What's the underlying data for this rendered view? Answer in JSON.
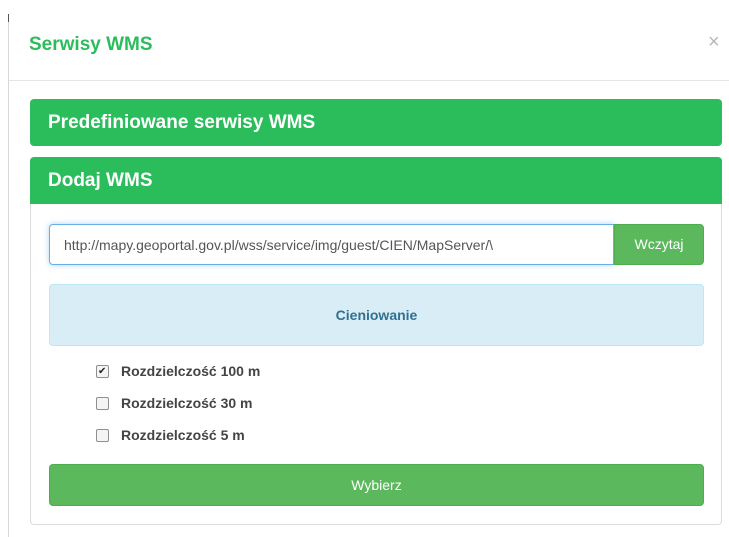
{
  "modal": {
    "title": "Serwisy WMS",
    "close_label": "×"
  },
  "panels": {
    "predefined": {
      "label": "Predefiniowane serwisy WMS"
    },
    "add": {
      "label": "Dodaj WMS"
    }
  },
  "add_form": {
    "url_value": "http://mapy.geoportal.gov.pl/wss/service/img/guest/CIEN/MapServer/\\",
    "load_label": "Wczytaj",
    "layer_title": "Cieniowanie",
    "options": [
      {
        "label": "Rozdzielczość 100 m",
        "checked": true
      },
      {
        "label": "Rozdzielczość 30 m",
        "checked": false
      },
      {
        "label": "Rozdzielczość 5 m",
        "checked": false
      }
    ],
    "select_label": "Wybierz"
  },
  "colors": {
    "accent": "#2bbd5b",
    "button": "#5cb85c",
    "info_bg": "#d9edf7",
    "info_text": "#31708f"
  },
  "icons": {
    "close": "close-icon",
    "checkbox": "checkbox-icon"
  }
}
